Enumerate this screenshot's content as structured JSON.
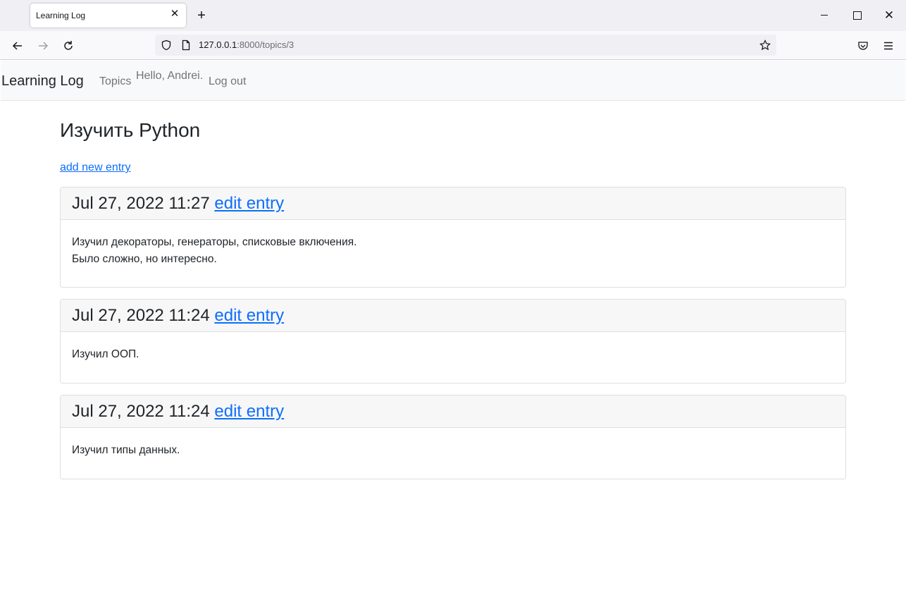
{
  "browser": {
    "tab_title": "Learning Log",
    "tab_close": "✕",
    "new_tab": "+",
    "close_window": "✕",
    "url_host": "127.0.0.1",
    "url_rest": ":8000/topics/3"
  },
  "site": {
    "brand": "Learning Log",
    "nav_topics": "Topics",
    "greeting": "Hello, Andrei.",
    "logout": "Log out"
  },
  "topic": {
    "title": "Изучить Python",
    "add_entry": "add new entry"
  },
  "entries": [
    {
      "date": "Jul 27, 2022 11:27",
      "edit": "edit entry",
      "lines": [
        "Изучил декораторы, генераторы, списковые включения.",
        "Было сложно, но интересно."
      ]
    },
    {
      "date": "Jul 27, 2022 11:24",
      "edit": "edit entry",
      "lines": [
        "Изучил ООП."
      ]
    },
    {
      "date": "Jul 27, 2022 11:24",
      "edit": "edit entry",
      "lines": [
        "Изучил типы данных."
      ]
    }
  ],
  "colors": {
    "link": "#0d6efd",
    "navbar_bg": "#f8f9fa",
    "card_header_bg": "#f7f7f7"
  }
}
